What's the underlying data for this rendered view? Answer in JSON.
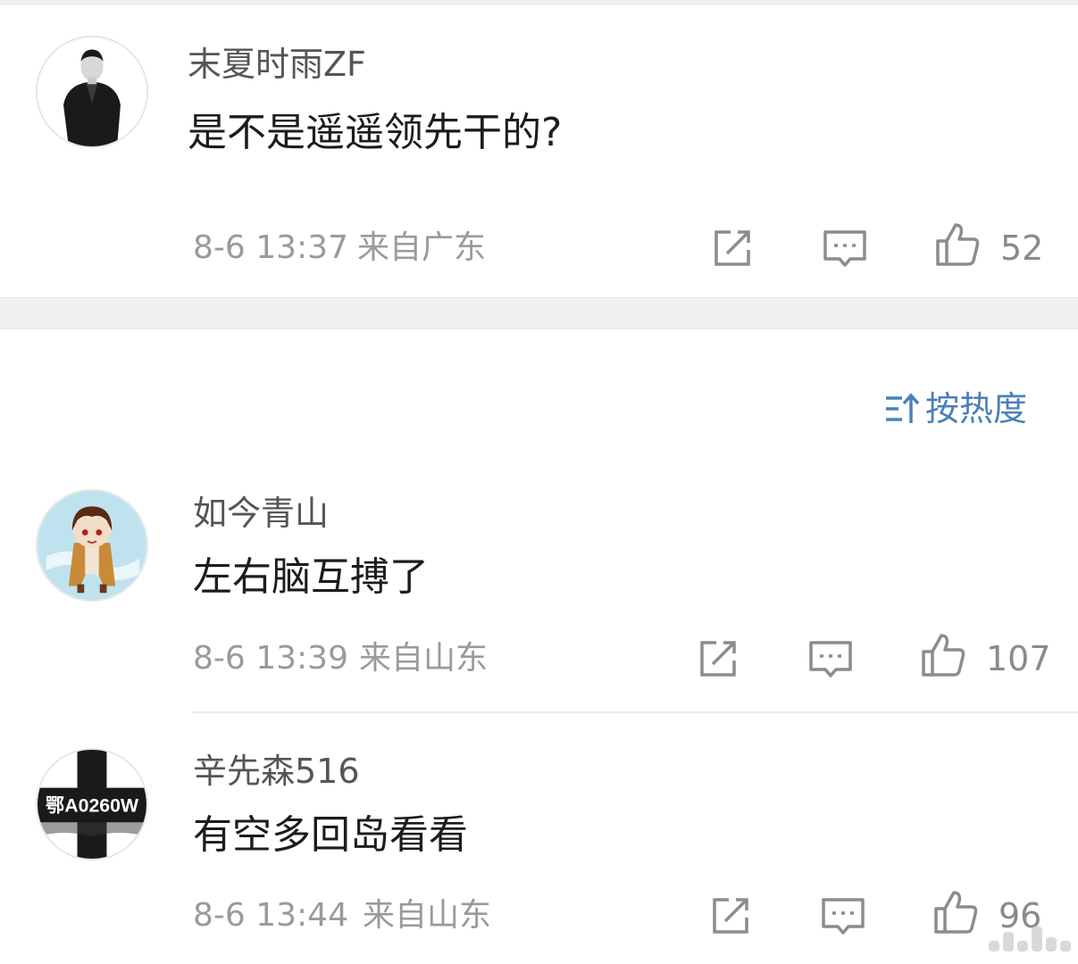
{
  "comments": [
    {
      "username": "末夏时雨ZF",
      "text": "是不是遥遥领先干的?",
      "time": "8-6 13:37",
      "location": "来自广东",
      "likes": "52",
      "avatar_icon": "person-in-dark-coat-avatar"
    },
    {
      "username": "如今青山",
      "text": "左右脑互搏了",
      "time": "8-6 13:39",
      "location": "来自山东",
      "likes": "107",
      "avatar_icon": "anime-character-avatar"
    },
    {
      "username": "辛先森516",
      "text": "有空多回岛看看",
      "time": "8-6 13:44",
      "location": "来自山东",
      "likes": "96",
      "avatar_icon": "license-plate-cross-avatar",
      "avatar_text": "鄂A0260W"
    }
  ],
  "sort": {
    "label": "按热度",
    "icon": "sort-arrows-icon"
  },
  "colors": {
    "accent": "#4a80b8",
    "meta": "#9a9a9a",
    "text": "#1c1c1c",
    "username": "#555555",
    "band": "#f0f0f0"
  },
  "icons": [
    "share-icon",
    "comment-icon",
    "like-icon"
  ]
}
